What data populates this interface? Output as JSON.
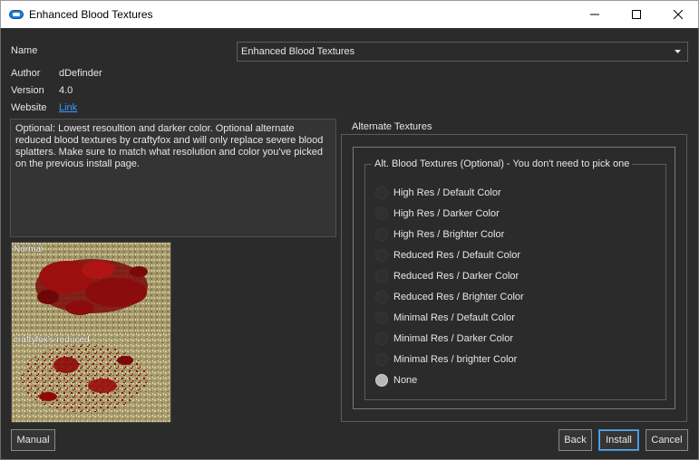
{
  "window": {
    "title": "Enhanced Blood Textures"
  },
  "info": {
    "name_label": "Name",
    "name_value": "Enhanced Blood Textures",
    "author_label": "Author",
    "author_value": "dDefinder",
    "version_label": "Version",
    "version_value": "4.0",
    "website_label": "Website",
    "website_link": "Link"
  },
  "description": "Optional: Lowest resoultion and darker color. Optional alternate reduced blood textures by craftyfox and will only replace severe blood splatters. Make sure to match what resolution and color you've picked on the previous install page.",
  "preview": {
    "top_label": "Normal",
    "bottom_label": "craftyfox's reduced"
  },
  "group": {
    "title": "Alternate Textures",
    "inner_title": "Alt. Blood Textures (Optional) - You don't need to pick one",
    "options": [
      {
        "label": "High Res / Default Color",
        "selected": false
      },
      {
        "label": "High Res / Darker Color",
        "selected": false
      },
      {
        "label": "High Res / Brighter Color",
        "selected": false
      },
      {
        "label": "Reduced Res / Default Color",
        "selected": false
      },
      {
        "label": "Reduced Res / Darker Color",
        "selected": false
      },
      {
        "label": "Reduced Res / Brighter Color",
        "selected": false
      },
      {
        "label": "Minimal Res / Default Color",
        "selected": false
      },
      {
        "label": "Minimal Res / Darker Color",
        "selected": false
      },
      {
        "label": "Minimal Res / brighter Color",
        "selected": false
      },
      {
        "label": "None",
        "selected": true
      }
    ]
  },
  "buttons": {
    "manual": "Manual",
    "back": "Back",
    "install": "Install",
    "cancel": "Cancel"
  },
  "colors": {
    "link": "#3a9bff",
    "accent": "#3a8fd8",
    "background": "#2b2b2b"
  }
}
